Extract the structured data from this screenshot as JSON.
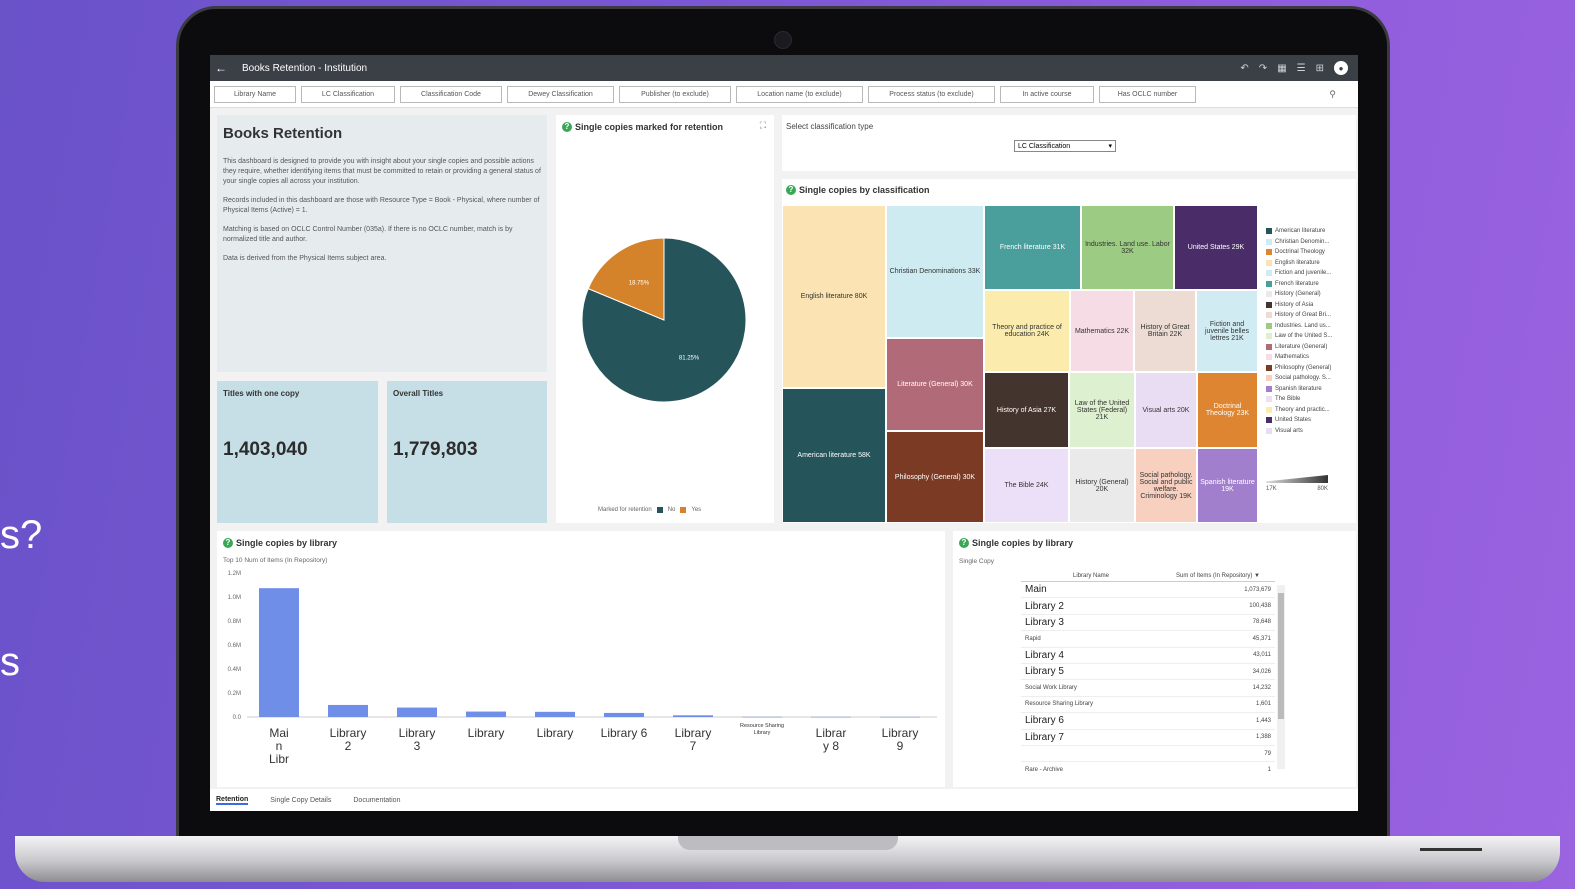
{
  "side_text": [
    "s?",
    "s"
  ],
  "window": {
    "title": "Books Retention - Institution"
  },
  "filters": [
    "Library Name",
    "LC Classification",
    "Classification Code",
    "Dewey Classification",
    "Publisher (to exclude)",
    "Location name (to exclude)",
    "Process status (to exclude)",
    "In active course",
    "Has OCLC number"
  ],
  "intro": {
    "title": "Books Retention",
    "paragraphs": [
      "This dashboard is designed to provide you with insight about your single copies and possible actions they require, whether identifying items that must be committed to retain or providing a general status of your single copies all across your institution.",
      "Records included in this dashboard are those with Resource Type = Book - Physical, where number of Physical Items (Active) = 1.",
      "Matching is based on OCLC Control Number (035a). If there is no OCLC number, match is by normalized title and author.",
      "Data is derived from the Physical Items subject area."
    ]
  },
  "kpis": [
    {
      "label": "Titles with one copy",
      "value": "1,403,040"
    },
    {
      "label": "Overall Titles",
      "value": "1,779,803"
    }
  ],
  "pie": {
    "title": "Single copies marked for retention",
    "legend_title": "Marked for retention",
    "slices": [
      {
        "name": "No",
        "pct": 81.25,
        "label": "81.25%",
        "color": "#25545b"
      },
      {
        "name": "Yes",
        "pct": 18.75,
        "label": "18.75%",
        "color": "#d4832a"
      }
    ]
  },
  "select": {
    "label": "Select classification type",
    "value": "LC Classification"
  },
  "treemap": {
    "title": "Single copies by classification",
    "cells": [
      {
        "label": "English literature 80K",
        "color": "#fbe3b4"
      },
      {
        "label": "American literature 58K",
        "color": "#25545b"
      },
      {
        "label": "Christian Denominations 33K",
        "color": "#cdebf1"
      },
      {
        "label": "Literature (General) 30K",
        "color": "#b16b78"
      },
      {
        "label": "Philosophy (General) 30K",
        "color": "#7a3a23"
      },
      {
        "label": "French literature 31K",
        "color": "#4a9e9b"
      },
      {
        "label": "Industries. Land use. Labor 32K",
        "color": "#9ccb83"
      },
      {
        "label": "United States 29K",
        "color": "#4a2d68"
      },
      {
        "label": "Theory and practice of education 24K",
        "color": "#fbecae"
      },
      {
        "label": "Mathematics 22K",
        "color": "#f6dce4"
      },
      {
        "label": "History of Great Britain 22K",
        "color": "#ecdcd3"
      },
      {
        "label": "Fiction and juvenile belles lettres 21K",
        "color": "#d0ecf2"
      },
      {
        "label": "History of Asia 27K",
        "color": "#44342e"
      },
      {
        "label": "Law of the United States (Federal) 21K",
        "color": "#ddf0cf"
      },
      {
        "label": "Visual arts 20K",
        "color": "#e9ddf4"
      },
      {
        "label": "Doctrinal Theology 23K",
        "color": "#dd8531"
      },
      {
        "label": "The Bible 24K",
        "color": "#ebe0f7"
      },
      {
        "label": "History (General) 20K",
        "color": "#eaeaea"
      },
      {
        "label": "Social pathology. Social and public welfare. Criminology 19K",
        "color": "#f7d0c0"
      },
      {
        "label": "Spanish literature 19K",
        "color": "#a27fcd"
      }
    ],
    "legend": [
      {
        "name": "American literature",
        "color": "#25545b"
      },
      {
        "name": "Christian Denomin...",
        "color": "#cdebf1"
      },
      {
        "name": "Doctrinal Theology",
        "color": "#dd8531"
      },
      {
        "name": "English literature",
        "color": "#fbe3b4"
      },
      {
        "name": "Fiction and juvenile...",
        "color": "#d0ecf2"
      },
      {
        "name": "French literature",
        "color": "#4a9e9b"
      },
      {
        "name": "History (General)",
        "color": "#eaeaea"
      },
      {
        "name": "History of Asia",
        "color": "#44342e"
      },
      {
        "name": "History of Great Bri...",
        "color": "#ecdcd3"
      },
      {
        "name": "Industries. Land us...",
        "color": "#9ccb83"
      },
      {
        "name": "Law of the United S...",
        "color": "#ddf0cf"
      },
      {
        "name": "Literature (General)",
        "color": "#b16b78"
      },
      {
        "name": "Mathematics",
        "color": "#f6dce4"
      },
      {
        "name": "Philosophy (General)",
        "color": "#7a3a23"
      },
      {
        "name": "Social pathology. S...",
        "color": "#f7d0c0"
      },
      {
        "name": "Spanish literature",
        "color": "#a27fcd"
      },
      {
        "name": "The Bible",
        "color": "#ebe0f7"
      },
      {
        "name": "Theory and practic...",
        "color": "#fbecae"
      },
      {
        "name": "United States",
        "color": "#4a2d68"
      },
      {
        "name": "Visual arts",
        "color": "#e9ddf4"
      }
    ],
    "scale_min": "17K",
    "scale_max": "80K"
  },
  "bar_panel": {
    "title": "Single copies by library",
    "subtitle": "Top 10 Num of Items (In Repository)",
    "chart_data": {
      "type": "bar",
      "categories": [
        "Main Library",
        "Library 2",
        "Library 3",
        "Library",
        "Library",
        "Library 6",
        "Library 7",
        "Resource Sharing Library",
        "Library 8",
        "Library 9"
      ],
      "values": [
        1073679,
        100438,
        78648,
        45371,
        43011,
        34026,
        14232,
        1601,
        1443,
        1388
      ],
      "ylim": [
        0,
        1200000
      ],
      "yticks": [
        "0.0",
        "0.2M",
        "0.4M",
        "0.6M",
        "0.8M",
        "1.0M",
        "1.2M"
      ],
      "tick_labels": [
        "Mai\nn\nLibr",
        "Library\n2",
        "Library\n3",
        "Library",
        "Library",
        "Library 6",
        "Library\n7",
        "Resource Sharing\nLibrary",
        "Librar\ny 8",
        "Library\n9"
      ],
      "color": "#6f8ee8"
    }
  },
  "table_panel": {
    "title": "Single copies by library",
    "subtitle": "Single Copy",
    "columns": [
      "Library Name",
      "Sum of Items (In Repository)"
    ],
    "rows": [
      {
        "name": "Main",
        "value": "1,073,679"
      },
      {
        "name": "Library 2",
        "value": "100,438"
      },
      {
        "name": "Library 3",
        "value": "78,648"
      },
      {
        "name": "Rapid",
        "value": "45,371"
      },
      {
        "name": "Library 4",
        "value": "43,011"
      },
      {
        "name": "Library 5",
        "value": "34,026"
      },
      {
        "name": "Social Work Library",
        "value": "14,232"
      },
      {
        "name": "Resource Sharing Library",
        "value": "1,601"
      },
      {
        "name": "Library 6",
        "value": "1,443"
      },
      {
        "name": "Library 7",
        "value": "1,388"
      },
      {
        "name": "",
        "value": "79"
      },
      {
        "name": "Rare - Archive",
        "value": "1"
      }
    ]
  },
  "tabs": [
    "Retention",
    "Single Copy Details",
    "Documentation"
  ]
}
